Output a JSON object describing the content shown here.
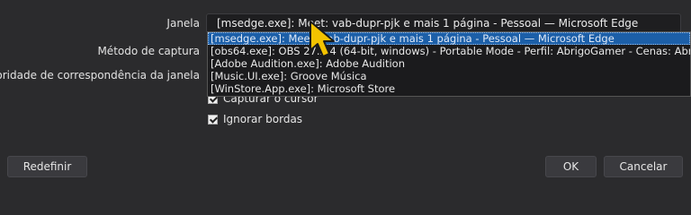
{
  "form": {
    "window_label": "Janela",
    "capture_method_label": "Método de captura",
    "match_priority_label": "Prioridade de correspondência da janela",
    "window_select_value": "[msedge.exe]: Meet: vab-dupr-pjk e mais 1 página - Pessoal — Microsoft Edge",
    "dropdown_options": [
      "[msedge.exe]: Meet: vab-dupr-pjk e mais 1 página - Pessoal — Microsoft Edge",
      "[obs64.exe]: OBS 27.2.4 (64-bit, windows) - Portable Mode - Perfil: AbrigoGamer - Cenas: AbrigoGamer",
      "[Adobe Audition.exe]: Adobe Audition",
      "[Music.UI.exe]: Groove Música",
      "[WinStore.App.exe]: Microsoft Store"
    ],
    "capture_cursor_label": "Capturar o cursor",
    "ignore_borders_label": "Ignorar bordas"
  },
  "buttons": {
    "reset": "Redefinir",
    "ok": "OK",
    "cancel": "Cancelar"
  },
  "colors": {
    "background": "#2b2b2d",
    "selection": "#1c5fa8",
    "cursor": "#f2c200"
  },
  "icons": {
    "cursor": "mouse-pointer-icon",
    "checkmark": "checkmark-icon"
  }
}
